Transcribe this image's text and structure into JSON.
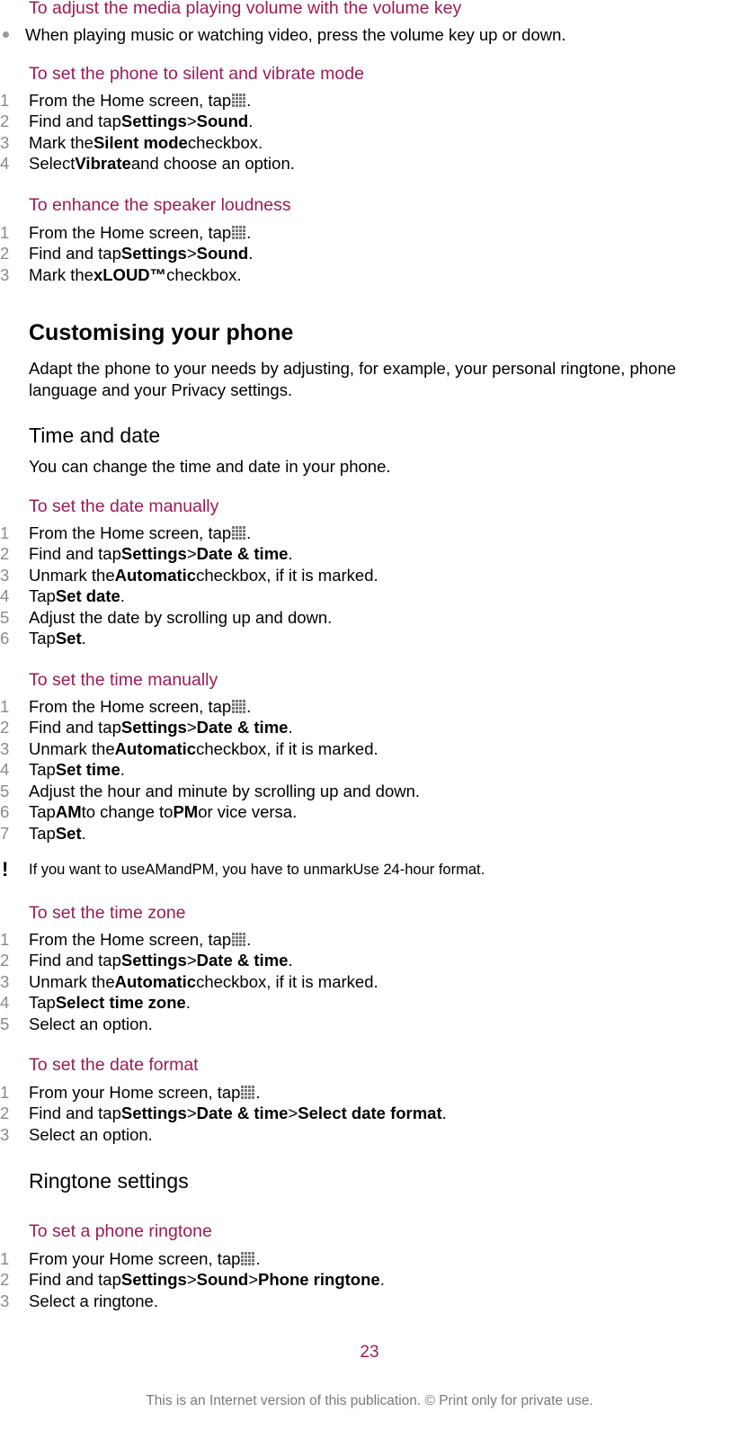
{
  "sections": {
    "volume": {
      "title": "To adjust the media playing volume with the volume key",
      "bullet": "When playing music or watching video, press the volume key up or down."
    },
    "silent": {
      "title": "To set the phone to silent and vibrate mode",
      "steps": [
        {
          "num": "1",
          "pre": "From the Home screen, tap ",
          "post": "."
        },
        {
          "num": "2",
          "pre": "Find and tap ",
          "b1": "Settings",
          "mid": " > ",
          "b2": "Sound",
          "post": "."
        },
        {
          "num": "3",
          "pre": "Mark the ",
          "b1": "Silent mode",
          "post": " checkbox."
        },
        {
          "num": "4",
          "pre": "Select ",
          "b1": "Vibrate",
          "post": " and choose an option."
        }
      ]
    },
    "loudness": {
      "title": "To enhance the speaker loudness",
      "steps": [
        {
          "num": "1",
          "pre": "From the Home screen, tap ",
          "post": "."
        },
        {
          "num": "2",
          "pre": "Find and tap ",
          "b1": "Settings",
          "mid": " > ",
          "b2": "Sound",
          "post": "."
        },
        {
          "num": "3",
          "pre": "Mark the ",
          "b1": "xLOUD™",
          "post": " checkbox."
        }
      ]
    },
    "customising": {
      "heading": "Customising your phone",
      "para": "Adapt the phone to your needs by adjusting, for example, your personal ringtone, phone language and your Privacy settings."
    },
    "timedate": {
      "heading": "Time and date",
      "para": "You can change the time and date in your phone."
    },
    "setdate": {
      "title": "To set the date manually",
      "steps": [
        {
          "num": "1",
          "pre": "From the Home screen, tap ",
          "post": "."
        },
        {
          "num": "2",
          "pre": "Find and tap ",
          "b1": "Settings",
          "mid": " > ",
          "b2": "Date & time",
          "post": "."
        },
        {
          "num": "3",
          "pre": "Unmark the ",
          "b1": "Automatic",
          "post": " checkbox, if it is marked."
        },
        {
          "num": "4",
          "pre": "Tap ",
          "b1": "Set date",
          "post": "."
        },
        {
          "num": "5",
          "pre": "Adjust the date by scrolling up and down."
        },
        {
          "num": "6",
          "pre": "Tap ",
          "b1": "Set",
          "post": "."
        }
      ]
    },
    "settime": {
      "title": "To set the time manually",
      "steps": [
        {
          "num": "1",
          "pre": "From the Home screen, tap ",
          "post": "."
        },
        {
          "num": "2",
          "pre": "Find and tap ",
          "b1": "Settings",
          "mid": " > ",
          "b2": "Date & time",
          "post": "."
        },
        {
          "num": "3",
          "pre": "Unmark the ",
          "b1": "Automatic",
          "post": " checkbox, if it is marked."
        },
        {
          "num": "4",
          "pre": "Tap ",
          "b1": "Set time",
          "post": "."
        },
        {
          "num": "5",
          "pre": "Adjust the hour and minute by scrolling up and down."
        },
        {
          "num": "6",
          "pre": "Tap ",
          "b1": "AM",
          "mid": " to change to ",
          "b2": "PM",
          "post": " or vice versa."
        },
        {
          "num": "7",
          "pre": "Tap ",
          "b1": "Set",
          "post": "."
        }
      ],
      "note": {
        "icon": "!",
        "pre": "If you want to use ",
        "b1": "AM",
        "mid": " and ",
        "b2": "PM",
        "mid2": ", you have to unmark ",
        "b3": "Use 24-hour format",
        "post": "."
      }
    },
    "timezone": {
      "title": "To set the time zone",
      "steps": [
        {
          "num": "1",
          "pre": "From the Home screen, tap ",
          "post": "."
        },
        {
          "num": "2",
          "pre": "Find and tap ",
          "b1": "Settings",
          "mid": " > ",
          "b2": "Date & time",
          "post": "."
        },
        {
          "num": "3",
          "pre": "Unmark the ",
          "b1": "Automatic",
          "post": " checkbox, if it is marked."
        },
        {
          "num": "4",
          "pre": "Tap ",
          "b1": "Select time zone",
          "post": "."
        },
        {
          "num": "5",
          "pre": "Select an option."
        }
      ]
    },
    "dateformat": {
      "title": "To set the date format",
      "steps": [
        {
          "num": "1",
          "pre": "From your Home screen, tap ",
          "post": " ."
        },
        {
          "num": "2",
          "pre": "Find and tap ",
          "b1": "Settings",
          "mid": " > ",
          "b2": "Date & time",
          "mid2": " > ",
          "b3": "Select date format",
          "post": "."
        },
        {
          "num": "3",
          "pre": "Select an option."
        }
      ]
    },
    "ringtone": {
      "heading": "Ringtone settings",
      "title": "To set a phone ringtone",
      "steps": [
        {
          "num": "1",
          "pre": "From your Home screen, tap ",
          "post": "."
        },
        {
          "num": "2",
          "pre": "Find and tap ",
          "b1": "Settings",
          "mid": " > ",
          "b2": "Sound",
          "mid2": " > ",
          "b3": "Phone ringtone",
          "post": "."
        },
        {
          "num": "3",
          "pre": "Select a ringtone."
        }
      ]
    }
  },
  "page_number": "23",
  "footer": "This is an Internet version of this publication. © Print only for private use.",
  "colors": {
    "accent": "#9b1c56",
    "step_number": "#8a8a8a",
    "footer": "#7a7a7a"
  }
}
